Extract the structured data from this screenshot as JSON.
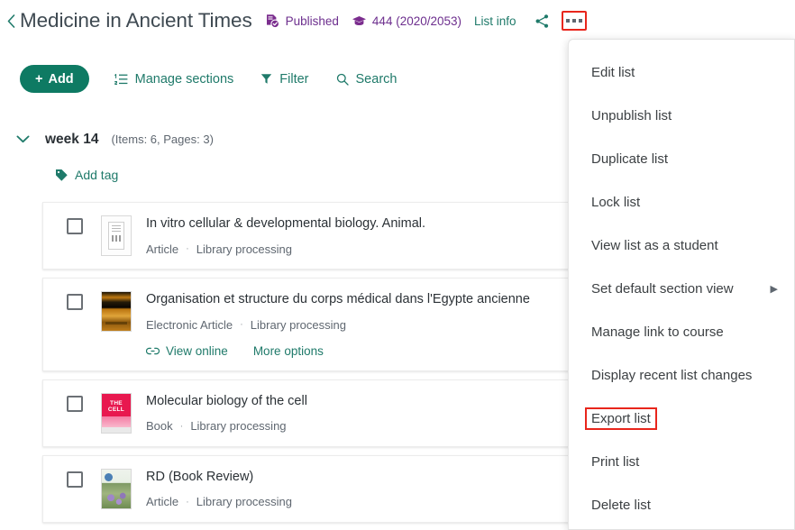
{
  "header": {
    "back_label": "‹",
    "title": "Medicine in Ancient Times",
    "published_label": "Published",
    "students_count": "444 (2020/2053)",
    "list_info_label": "List info",
    "share_icon": "share-icon",
    "more_icon": "more-options-icon",
    "published_icon": "published-document-check-icon",
    "students_icon": "graduation-cap-icon",
    "accent_purple": "#6d2f8e",
    "accent_teal": "#1f7a6a",
    "highlight_red": "#e8261c"
  },
  "toolbar": {
    "add_label": "Add",
    "add_plus": "+",
    "manage_sections_label": "Manage sections",
    "filter_label": "Filter",
    "search_label": "Search"
  },
  "section": {
    "caret": "⌄",
    "name": "week 14",
    "meta": "(Items: 6, Pages: 3)",
    "add_tag_label": "Add tag"
  },
  "items": [
    {
      "title": "In vitro cellular & developmental biology. Animal.",
      "type": "Article",
      "status": "Library processing",
      "separator": "·",
      "thumb": "document-placeholder-thumbnail",
      "actions": []
    },
    {
      "title": "Organisation et structure du corps médical dans l'Egypte ancienne",
      "type": "Electronic Article",
      "status": "Library processing",
      "separator": "·",
      "thumb": "orange-book-cover-thumbnail",
      "actions": [
        {
          "label": "View online",
          "icon": "link-icon"
        },
        {
          "label": "More options",
          "icon": ""
        }
      ]
    },
    {
      "title": "Molecular biology of the cell",
      "type": "Book",
      "status": "Library processing",
      "separator": "·",
      "thumb": "the-cell-book-cover-thumbnail",
      "actions": []
    },
    {
      "title": "RD (Book Review)",
      "type": "Article",
      "status": "Library processing",
      "separator": "·",
      "thumb": "green-journal-cover-thumbnail",
      "actions": []
    }
  ],
  "menu": {
    "items": [
      {
        "label": "Edit list",
        "submenu": false,
        "highlighted": false
      },
      {
        "label": "Unpublish list",
        "submenu": false,
        "highlighted": false
      },
      {
        "label": "Duplicate list",
        "submenu": false,
        "highlighted": false
      },
      {
        "label": "Lock list",
        "submenu": false,
        "highlighted": false
      },
      {
        "label": "View list as a student",
        "submenu": false,
        "highlighted": false
      },
      {
        "label": "Set default section view",
        "submenu": true,
        "highlighted": false
      },
      {
        "label": "Manage link to course",
        "submenu": false,
        "highlighted": false
      },
      {
        "label": "Display recent list changes",
        "submenu": false,
        "highlighted": false
      },
      {
        "label": "Export list",
        "submenu": false,
        "highlighted": true
      },
      {
        "label": "Print list",
        "submenu": false,
        "highlighted": false
      },
      {
        "label": "Delete list",
        "submenu": false,
        "highlighted": false
      }
    ],
    "submenu_caret": "▶"
  }
}
